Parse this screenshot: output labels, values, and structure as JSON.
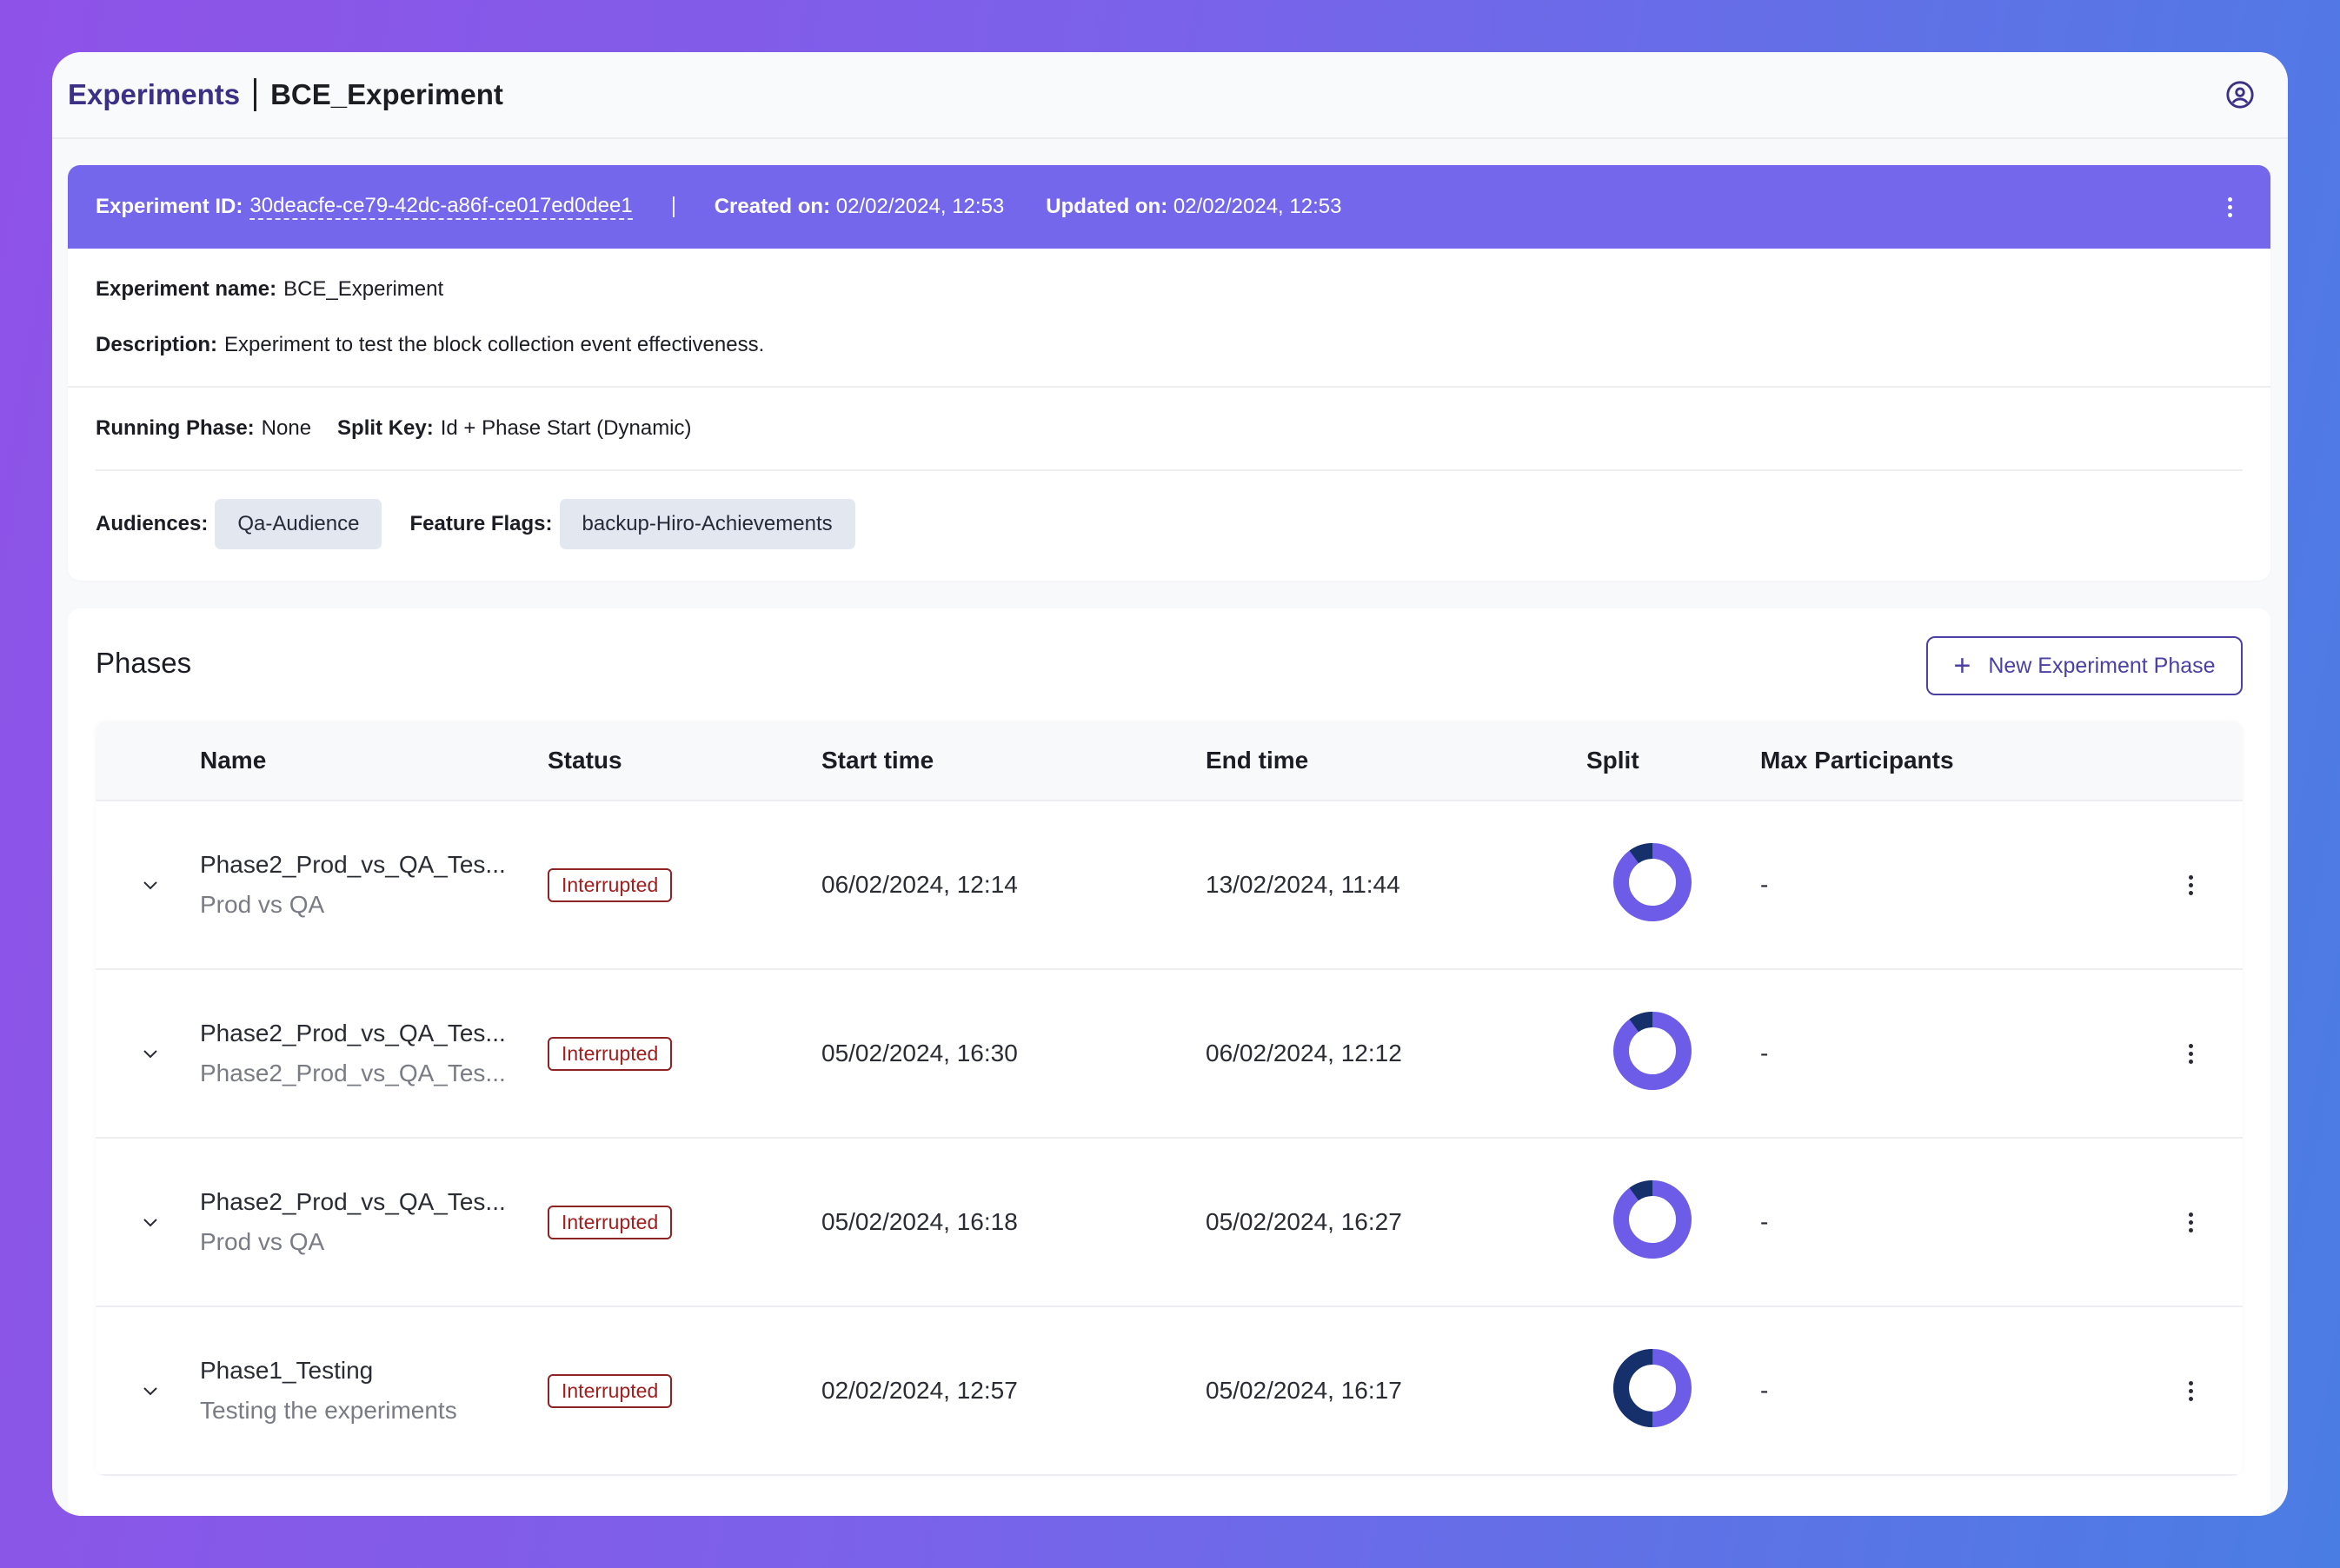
{
  "topbar": {
    "breadcrumb_root": "Experiments",
    "breadcrumb_current": "BCE_Experiment",
    "user_icon": "user-circle-icon"
  },
  "experiment": {
    "id_label": "Experiment ID:",
    "id_value": "30deacfe-ce79-42dc-a86f-ce017ed0dee1",
    "created_label": "Created on:",
    "created_value": "02/02/2024, 12:53",
    "updated_label": "Updated on:",
    "updated_value": "02/02/2024, 12:53",
    "name_label": "Experiment name:",
    "name_value": "BCE_Experiment",
    "description_label": "Description:",
    "description_value": "Experiment to test the block collection event effectiveness.",
    "running_phase_label": "Running Phase:",
    "running_phase_value": "None",
    "split_key_label": "Split Key:",
    "split_key_value": "Id + Phase Start (Dynamic)",
    "audiences_label": "Audiences:",
    "audiences": [
      "Qa-Audience"
    ],
    "feature_flags_label": "Feature Flags:",
    "feature_flags": [
      "backup-Hiro-Achievements"
    ],
    "header_color": "#7467ec"
  },
  "phases": {
    "title": "Phases",
    "new_button_label": "New Experiment Phase",
    "columns": [
      "Name",
      "Status",
      "Start time",
      "End time",
      "Split",
      "Max Participants"
    ],
    "split_colors": {
      "primary": "#6c5ce7",
      "secondary": "#15306b"
    },
    "rows": [
      {
        "name": "Phase2_Prod_vs_QA_Tes...",
        "subtitle": "Prod vs QA",
        "status": "Interrupted",
        "start": "06/02/2024, 12:14",
        "end": "13/02/2024, 11:44",
        "split": [
          10,
          90
        ],
        "max_participants": "-"
      },
      {
        "name": "Phase2_Prod_vs_QA_Tes...",
        "subtitle": "Phase2_Prod_vs_QA_Tes...",
        "status": "Interrupted",
        "start": "05/02/2024, 16:30",
        "end": "06/02/2024, 12:12",
        "split": [
          10,
          90
        ],
        "max_participants": "-"
      },
      {
        "name": "Phase2_Prod_vs_QA_Tes...",
        "subtitle": "Prod vs QA",
        "status": "Interrupted",
        "start": "05/02/2024, 16:18",
        "end": "05/02/2024, 16:27",
        "split": [
          10,
          90
        ],
        "max_participants": "-"
      },
      {
        "name": "Phase1_Testing",
        "subtitle": "Testing the experiments",
        "status": "Interrupted",
        "start": "02/02/2024, 12:57",
        "end": "05/02/2024, 16:17",
        "split": [
          50,
          50
        ],
        "max_participants": "-"
      }
    ]
  }
}
